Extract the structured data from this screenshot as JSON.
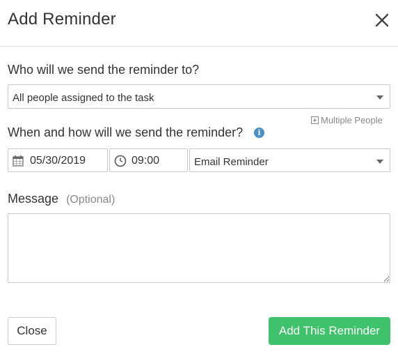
{
  "dialog": {
    "title": "Add Reminder"
  },
  "recipient": {
    "question": "Who will we send the reminder to?",
    "selected": "All people assigned to the task",
    "multiple_link": "Multiple People"
  },
  "schedule": {
    "question": "When and how will we send the reminder?",
    "date": "05/30/2019",
    "time": "09:00",
    "method": "Email Reminder"
  },
  "message": {
    "label": "Message",
    "optional": "(Optional)",
    "value": ""
  },
  "buttons": {
    "close": "Close",
    "add": "Add This Reminder"
  },
  "colors": {
    "primary": "#3ec26b",
    "info": "#4a90c8"
  },
  "icons": [
    "close-icon",
    "chevron-down-icon",
    "plus-square-icon",
    "info-icon",
    "calendar-icon",
    "clock-icon"
  ]
}
